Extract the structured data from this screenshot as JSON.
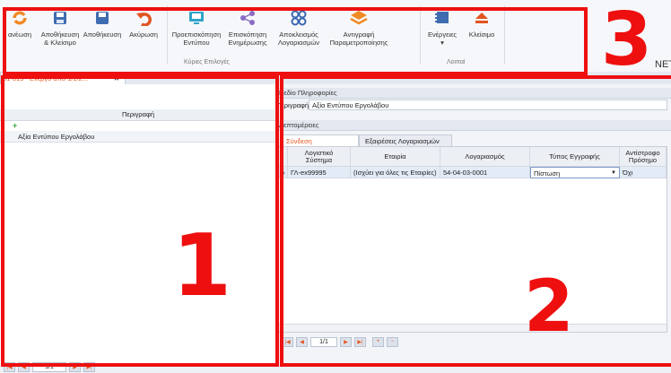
{
  "ribbon": {
    "buttons": [
      {
        "label": "ανέωση",
        "icon": "refresh-icon"
      },
      {
        "label": "Αποθήκευση\n& Κλείσιμο",
        "icon": "save-close-icon"
      },
      {
        "label": "Αποθήκευση",
        "icon": "save-icon"
      },
      {
        "label": "Ακύρωση",
        "icon": "undo-icon"
      },
      {
        "label": "Προεπισκόπηση\nΕντύπου",
        "icon": "monitor-icon"
      },
      {
        "label": "Επισκόπηση\nΕνημέρωσης",
        "icon": "share-icon"
      },
      {
        "label": "Αποκλεισμός\nΛογαριασμών",
        "icon": "blocks-icon"
      },
      {
        "label": "Αντιγραφή\nΠαραμετροποίησης",
        "icon": "layers-icon"
      },
      {
        "label": "Ενέργειες\n▾",
        "icon": "actions-icon"
      },
      {
        "label": "Κλείσιμο",
        "icon": "eject-icon"
      }
    ],
    "group_main": "Κύριες Επιλογές",
    "group_other": "Λοιπαί",
    "brand_fragment": "NET"
  },
  "left": {
    "doc_tab": "01-019 - Ενεργό από 1/1/2...",
    "close": "✕",
    "column_header": "Περιγραφή",
    "filter_icon": "+",
    "selected_row": "Αξία Εντύπου Εργολάβου",
    "pager_page": "1/1"
  },
  "right": {
    "info_section": "Πεδίο Πληροφορίες",
    "desc_label": "Περιγραφή",
    "desc_value": "Αξία Εντύπου Εργολάβου",
    "details_section": "Λεπτομέρειες",
    "tabs": [
      "Σύνδεση Λογαριασμών",
      "Εξαιρέσεις Λογαριασμών"
    ],
    "grid": {
      "headers": [
        "Λογιστικό\nΣύστημα",
        "Εταιρία",
        "Λογαριασμός",
        "Τύπος Εγγραφής",
        "Αντίστροφο\nΠρόσημο"
      ],
      "row": [
        "ΓΛ-ex99995",
        "(Ισχύει για όλες τις Εταιρίες)",
        "54-04-03-0001",
        "Πίστωση",
        "Όχι"
      ]
    },
    "pager_page": "1/1"
  },
  "annotations": {
    "one": "1",
    "two": "2",
    "three": "3"
  },
  "colors": {
    "accent": "#e4571e",
    "annotation": "#ee0f0f"
  }
}
